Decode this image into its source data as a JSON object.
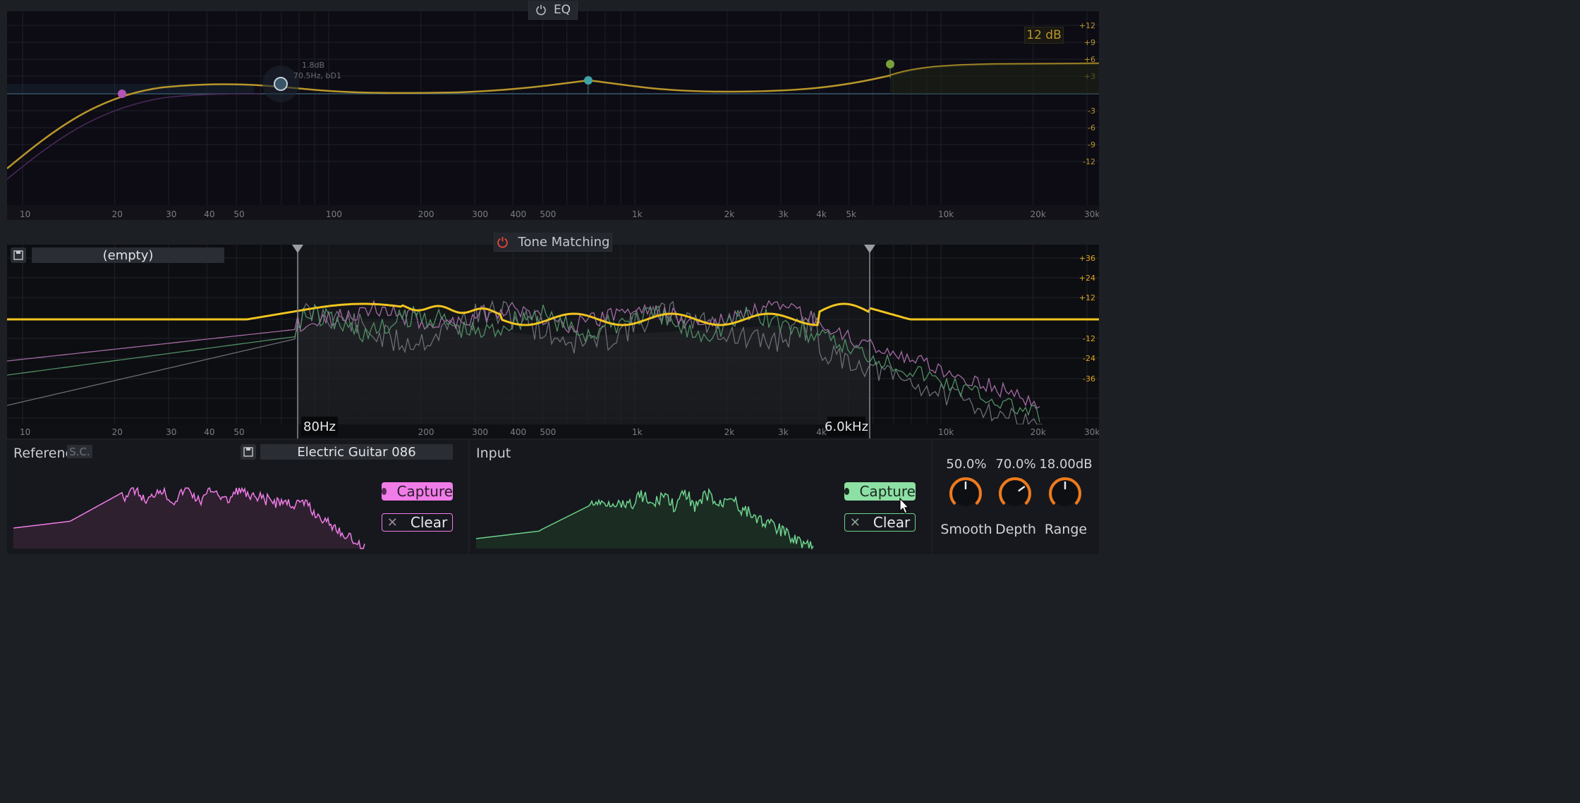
{
  "eq": {
    "title": "EQ",
    "db_range": "12 dB",
    "node_tooltip": {
      "gain": "1.8dB",
      "freq": "70.5Hz, bD1"
    },
    "db_labels": [
      "+12",
      "+9",
      "+6",
      "+3",
      "-3",
      "-6",
      "-9",
      "-12"
    ],
    "freq_labels": [
      "10",
      "20",
      "30",
      "40",
      "50",
      "100",
      "200",
      "300",
      "400",
      "500",
      "1k",
      "2k",
      "3k",
      "4k",
      "5k",
      "10k",
      "20k",
      "30k"
    ]
  },
  "tone": {
    "title": "Tone Matching",
    "preset": "(empty)",
    "low_freq": "80Hz",
    "high_freq": "6.0kHz",
    "db_labels": [
      "+36",
      "+24",
      "+12",
      "-12",
      "-24",
      "-36"
    ],
    "freq_labels": [
      "10",
      "20",
      "30",
      "40",
      "50",
      "200",
      "300",
      "400",
      "500",
      "1k",
      "2k",
      "3k",
      "4k",
      "10k",
      "20k",
      "30k"
    ]
  },
  "reference": {
    "label": "Reference",
    "sc": "S.C.",
    "preset": "Electric Guitar 086",
    "capture": "Capture",
    "clear": "Clear"
  },
  "input": {
    "label": "Input",
    "capture": "Capture",
    "clear": "Clear"
  },
  "knobs": {
    "smooth": {
      "value": "50.0%",
      "name": "Smooth",
      "level": 0.5
    },
    "depth": {
      "value": "70.0%",
      "name": "Depth",
      "level": 0.7
    },
    "range": {
      "value": "18.00dB",
      "name": "Range",
      "level": 0.5
    }
  },
  "colors": {
    "eq_curve": "#b8962a",
    "tone_curve": "#f2c51f",
    "reference": "#f07ce8",
    "input": "#6ed48e",
    "knob_accent": "#f07a1c"
  }
}
